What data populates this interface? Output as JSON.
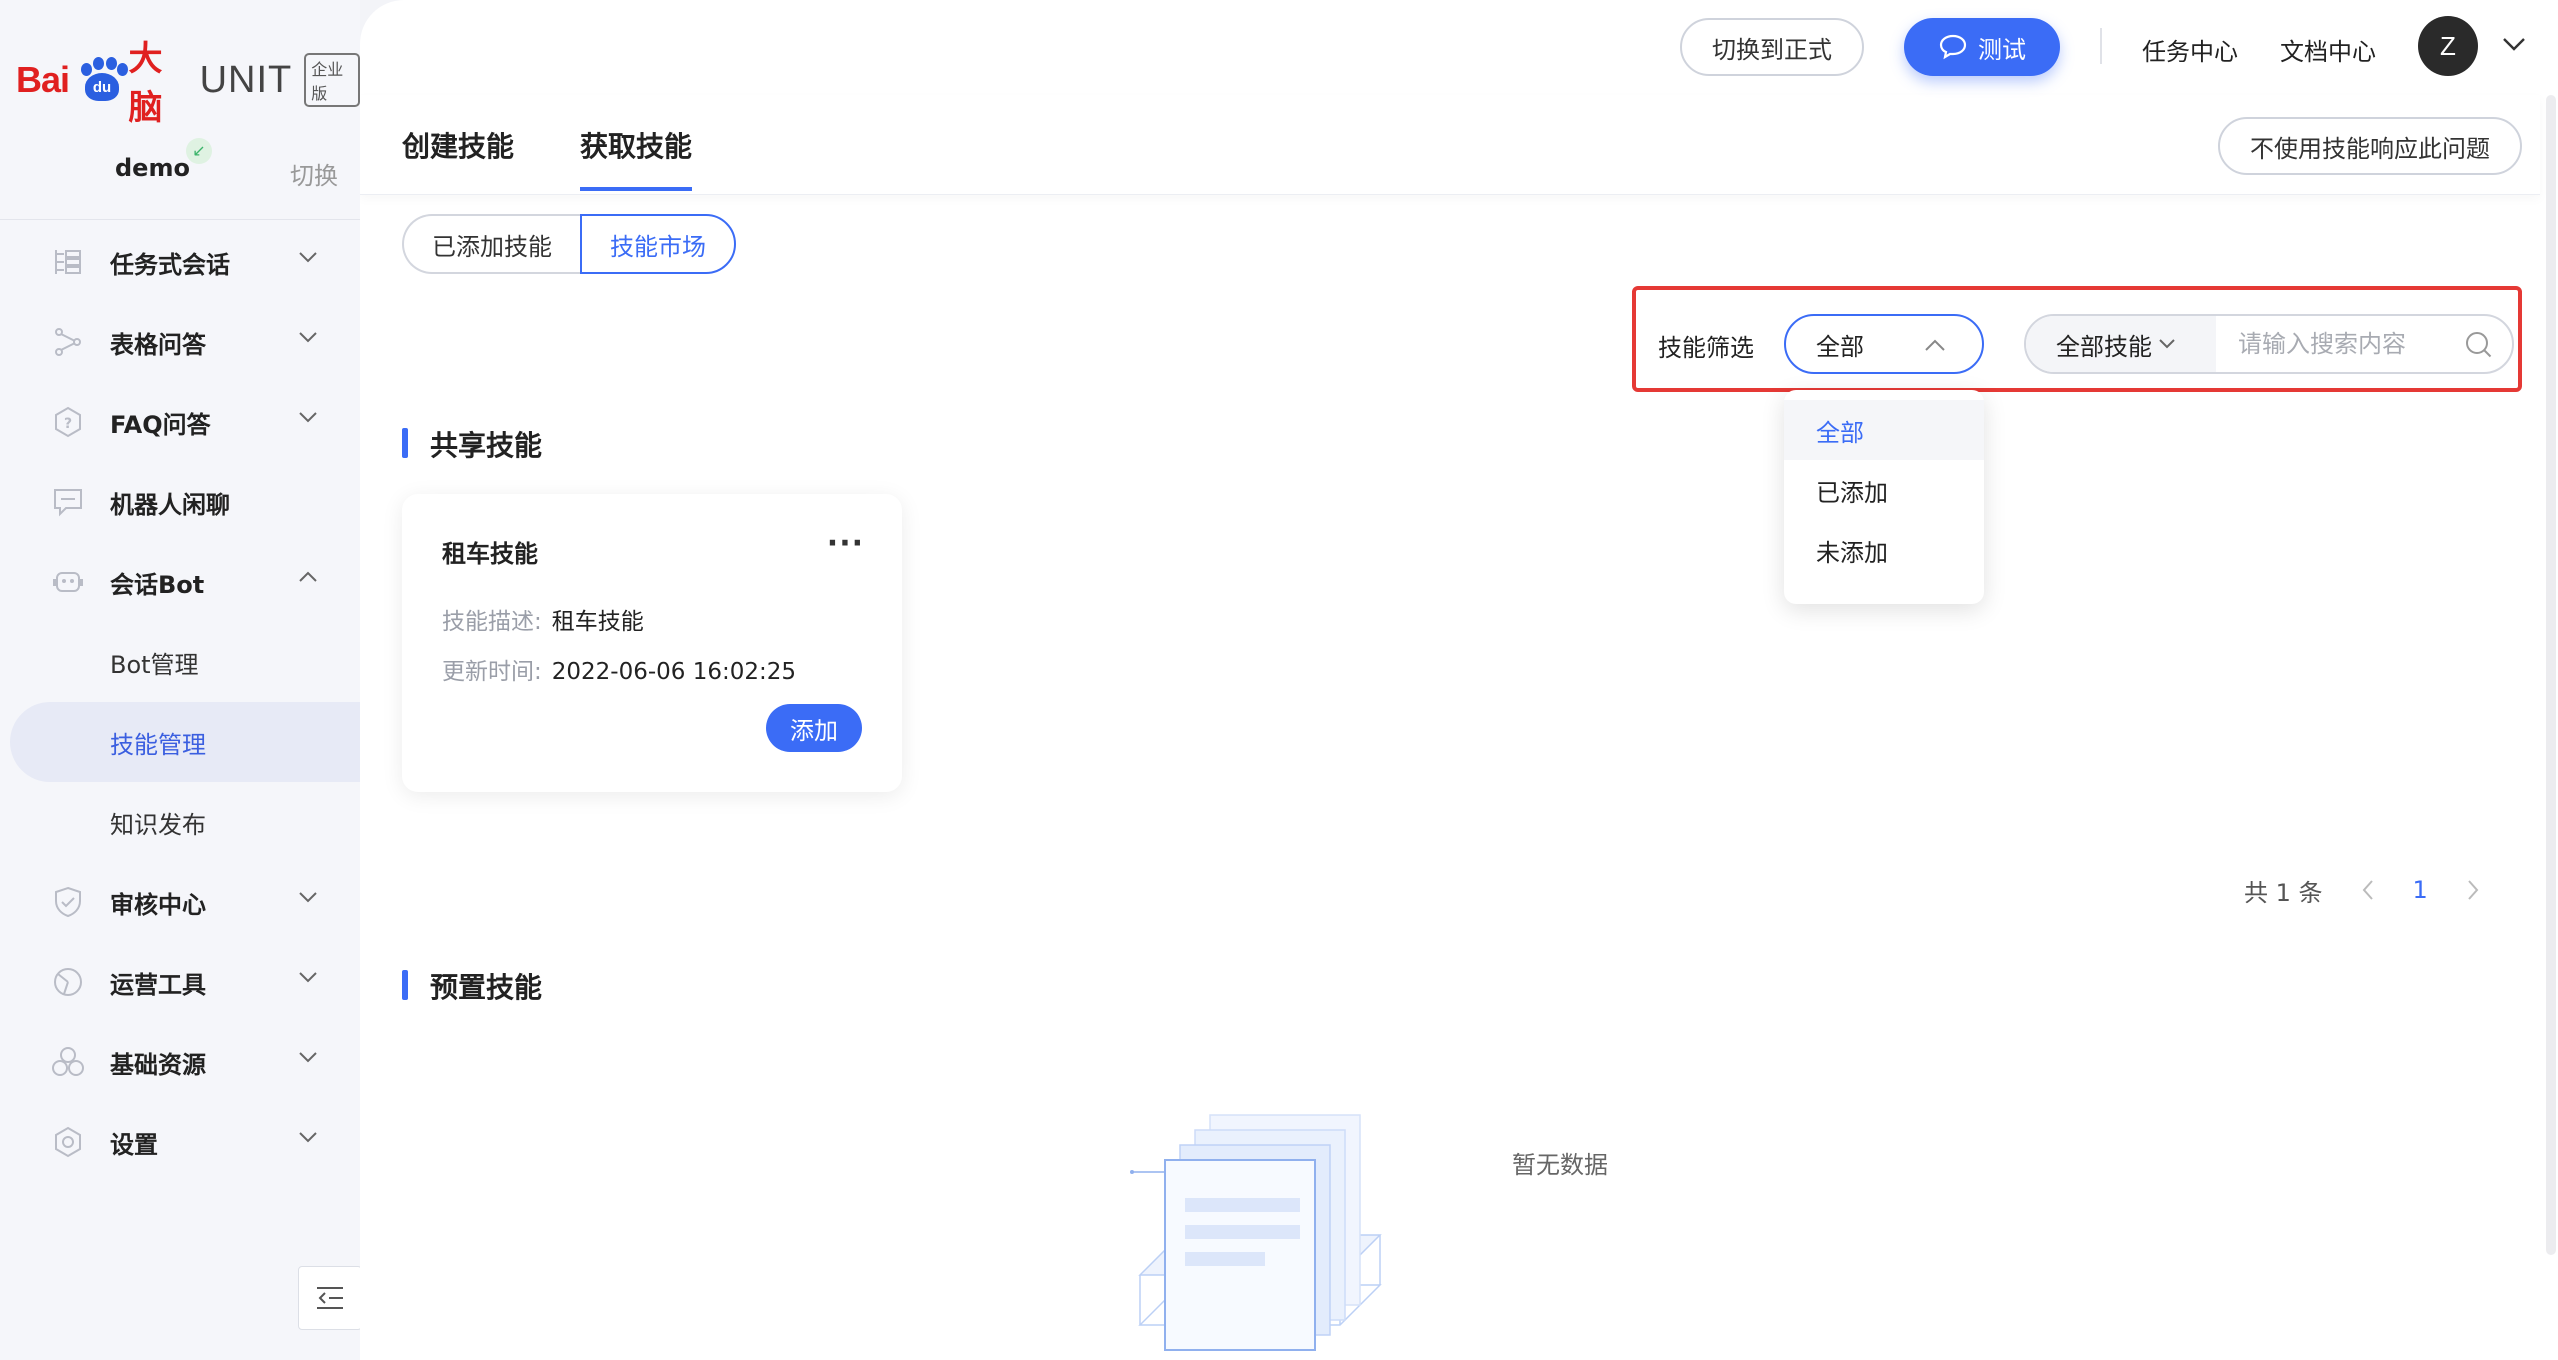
{
  "app": {
    "logo_text_1": "Bai",
    "logo_paw_text": "du",
    "logo_text_2": "大脑",
    "logo_unit": "UNIT",
    "logo_edition": "企业版"
  },
  "workspace": {
    "name": "demo",
    "switch_label": "切换"
  },
  "sidebar": {
    "items": [
      {
        "label": "任务式会话",
        "icon": "task-dialog-icon",
        "expanded": false
      },
      {
        "label": "表格问答",
        "icon": "table-qa-icon",
        "expanded": false
      },
      {
        "label": "FAQ问答",
        "icon": "faq-icon",
        "expanded": false
      },
      {
        "label": "机器人闲聊",
        "icon": "chat-icon"
      },
      {
        "label": "会话Bot",
        "icon": "bot-icon",
        "expanded": true
      },
      {
        "label": "审核中心",
        "icon": "shield-icon",
        "expanded": false
      },
      {
        "label": "运营工具",
        "icon": "chart-icon",
        "expanded": false
      },
      {
        "label": "基础资源",
        "icon": "resource-icon",
        "expanded": false
      },
      {
        "label": "设置",
        "icon": "gear-icon",
        "expanded": false
      }
    ],
    "bot_children": [
      {
        "label": "Bot管理"
      },
      {
        "label": "技能管理",
        "active": true
      },
      {
        "label": "知识发布"
      }
    ]
  },
  "topbar": {
    "switch_formal": "切换到正式",
    "test": "测试",
    "task_center": "任务中心",
    "doc_center": "文档中心",
    "avatar_initial": "Z"
  },
  "tabs": {
    "create": "创建技能",
    "acquire": "获取技能",
    "no_skill_response": "不使用技能响应此问题"
  },
  "segment": {
    "added": "已添加技能",
    "market": "技能市场"
  },
  "filter": {
    "label": "技能筛选",
    "selected": "全部",
    "options": [
      "全部",
      "已添加",
      "未添加"
    ],
    "search_type": "全部技能",
    "search_placeholder": "请输入搜索内容"
  },
  "shared": {
    "title": "共享技能",
    "cards": [
      {
        "name": "租车技能",
        "desc_label": "技能描述:",
        "desc": "租车技能",
        "time_label": "更新时间:",
        "time": "2022-06-06 16:02:25",
        "add": "添加"
      }
    ],
    "pager": {
      "total": "共 1 条",
      "current": "1"
    }
  },
  "preset": {
    "title": "预置技能",
    "empty": "暂无数据"
  },
  "colors": {
    "primary": "#3b6cf6",
    "highlight_border": "#e53935",
    "brand_red": "#e02020"
  }
}
